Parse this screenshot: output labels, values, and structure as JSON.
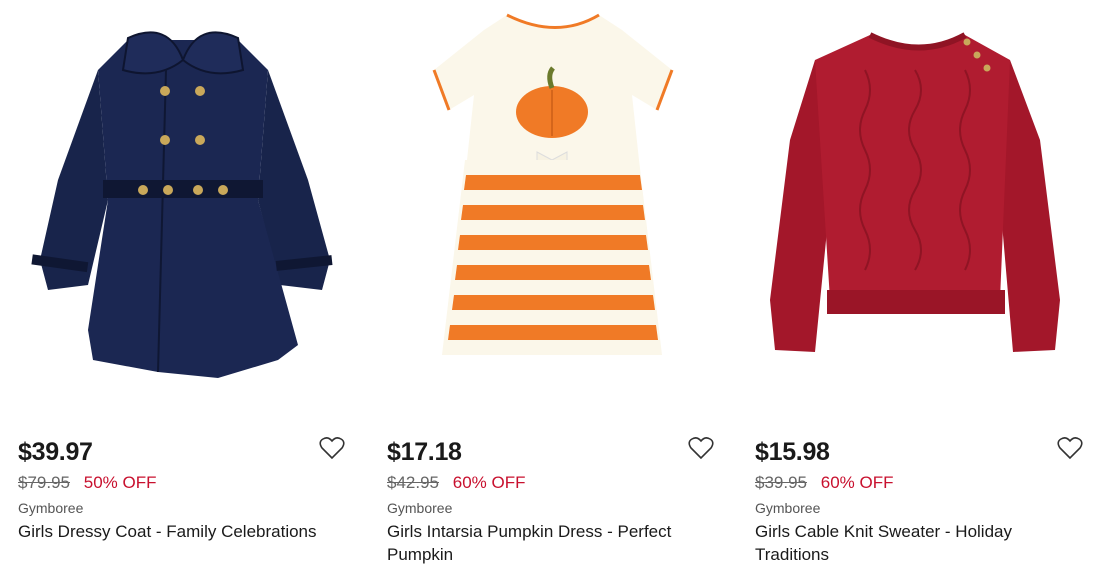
{
  "products": [
    {
      "price": "$39.97",
      "original_price": "$79.95",
      "discount": "50% OFF",
      "brand": "Gymboree",
      "name": "Girls Dressy Coat - Family Celebrations",
      "image_icon": "navy-coat-image",
      "color": "#17224a"
    },
    {
      "price": "$17.18",
      "original_price": "$42.95",
      "discount": "60% OFF",
      "brand": "Gymboree",
      "name": "Girls Intarsia Pumpkin Dress - Perfect Pumpkin",
      "image_icon": "pumpkin-dress-image",
      "color": "#f07a26"
    },
    {
      "price": "$15.98",
      "original_price": "$39.95",
      "discount": "60% OFF",
      "brand": "Gymboree",
      "name": "Girls Cable Knit Sweater - Holiday Traditions",
      "image_icon": "red-sweater-image",
      "color": "#a3172a"
    }
  ],
  "favorite_icon": "heart-outline-icon",
  "discount_color": "#c8102e"
}
